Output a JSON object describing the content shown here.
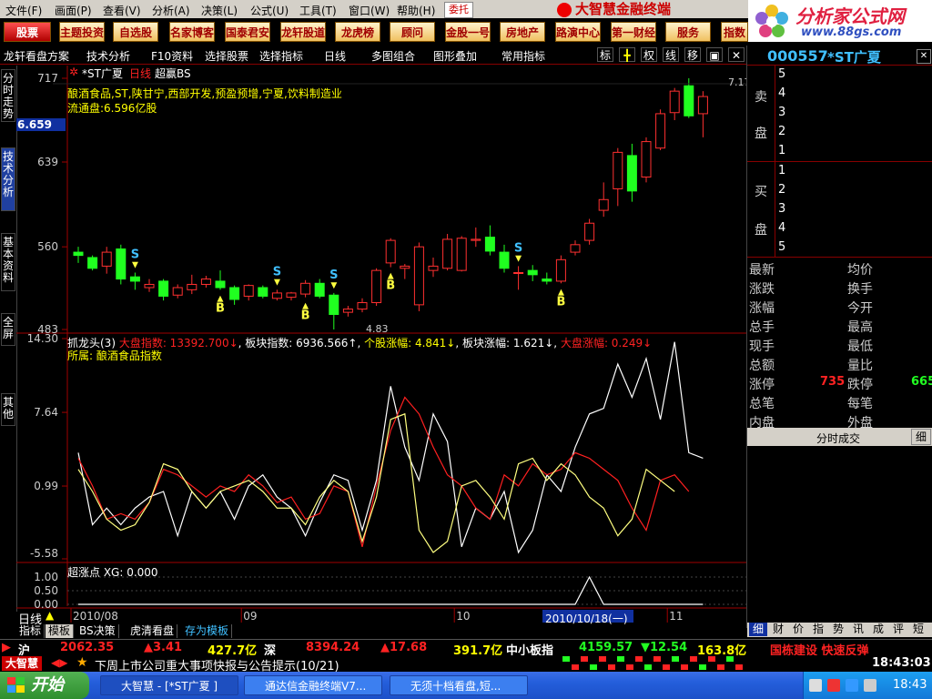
{
  "menu": [
    "文件(F)",
    "画面(P)",
    "查看(V)",
    "分析(A)",
    "决策(L)",
    "公式(U)",
    "工具(T)",
    "窗口(W)",
    "帮助(H)"
  ],
  "weituo": "委托",
  "brand": "大智慧金融终端",
  "site": {
    "name": "分析家公式网",
    "url": "www.88gs.com"
  },
  "toolbar": [
    "股票",
    "主题投资",
    "自选股",
    "名家博客",
    "国泰君安",
    "龙轩股道",
    "龙虎榜",
    "顾问",
    "金股一号",
    "房地产",
    "路演中心",
    "第一财经",
    "服务",
    "指数"
  ],
  "tabrow": [
    "龙轩看盘方案",
    "技术分析",
    "F10资料",
    "选择股票",
    "选择指标",
    "日线",
    "多图组合",
    "图形叠加",
    "常用指标"
  ],
  "tabrow_btns": [
    "标",
    "╋",
    "权",
    "线",
    "移"
  ],
  "left_tabs": [
    "分时走势",
    "技术分析",
    "基本资料",
    "全屏",
    "其他"
  ],
  "chart": {
    "header": "*ST广夏",
    "period": "日线",
    "indicator": "超赢BS",
    "info_line1": "酿酒食品,ST,陕甘宁,西部开发,预盈预增,宁夏,饮料制造业",
    "info_line2": "流通盘:6.596亿股",
    "cur_price": "6.659",
    "low_mark": "4.83",
    "high_mark": "7.17",
    "sub1_name": "抓龙头(3)",
    "sub1_vals": [
      "大盘指数: 13392.700↓",
      "板块指数: 6936.566↑",
      "个股涨幅: 4.841↓",
      "板块涨幅: 1.621↓",
      "大盘涨幅: 0.249↓"
    ],
    "sub1_sector": "所属: 酿酒食品指数",
    "sub2_name": "超涨点 XG: 0.000",
    "date_cursor": "2010/10/18(一)"
  },
  "chart_data": [
    {
      "type": "candlestick",
      "yticks": [
        "717",
        "639",
        "560",
        "483"
      ],
      "ylim": [
        4.83,
        7.17
      ],
      "x_month_labels": [
        "2010/08",
        "09",
        "10",
        "11"
      ],
      "candles": [
        [
          5.55,
          5.52,
          5.6,
          5.45
        ],
        [
          5.5,
          5.4,
          5.52,
          5.38
        ],
        [
          5.42,
          5.55,
          5.6,
          5.35
        ],
        [
          5.58,
          5.3,
          5.62,
          5.25
        ],
        [
          5.32,
          5.28,
          5.36,
          5.2
        ],
        [
          5.22,
          5.25,
          5.3,
          5.18
        ],
        [
          5.28,
          5.14,
          5.3,
          5.1
        ],
        [
          5.15,
          5.22,
          5.25,
          5.12
        ],
        [
          5.2,
          5.25,
          5.34,
          5.16
        ],
        [
          5.25,
          5.3,
          5.33,
          5.22
        ],
        [
          5.28,
          5.22,
          5.38,
          5.2
        ],
        [
          5.22,
          5.11,
          5.24,
          5.06
        ],
        [
          5.14,
          5.24,
          5.25,
          5.1
        ],
        [
          5.22,
          5.14,
          5.24,
          5.12
        ],
        [
          5.12,
          5.17,
          5.2,
          5.1
        ],
        [
          5.13,
          5.17,
          5.18,
          5.1
        ],
        [
          5.16,
          5.26,
          5.29,
          5.13
        ],
        [
          5.26,
          5.14,
          5.3,
          5.12
        ],
        [
          5.15,
          4.97,
          5.17,
          4.83
        ],
        [
          4.99,
          5.02,
          5.05,
          4.95
        ],
        [
          5.02,
          5.08,
          5.12,
          4.99
        ],
        [
          5.08,
          5.38,
          5.4,
          5.05
        ],
        [
          5.45,
          5.66,
          5.68,
          5.41
        ],
        [
          5.4,
          5.42,
          5.44,
          5.3
        ],
        [
          5.06,
          5.6,
          5.64,
          5.0
        ],
        [
          5.38,
          5.42,
          5.5,
          5.32
        ],
        [
          5.4,
          5.67,
          5.72,
          5.38
        ],
        [
          5.38,
          5.68,
          5.7,
          5.37
        ],
        [
          5.66,
          5.67,
          5.78,
          5.6
        ],
        [
          5.69,
          5.56,
          5.8,
          5.52
        ],
        [
          5.55,
          5.4,
          5.62,
          5.36
        ],
        [
          5.36,
          5.36,
          5.42,
          5.2
        ],
        [
          5.38,
          5.34,
          5.43,
          5.28
        ],
        [
          5.3,
          5.28,
          5.36,
          5.25
        ],
        [
          5.28,
          5.48,
          5.52,
          5.26
        ],
        [
          5.55,
          5.62,
          5.66,
          5.52
        ],
        [
          5.66,
          5.82,
          5.86,
          5.62
        ],
        [
          5.94,
          6.04,
          6.2,
          5.88
        ],
        [
          6.14,
          6.48,
          6.52,
          5.98
        ],
        [
          6.45,
          6.12,
          6.56,
          6.02
        ],
        [
          6.25,
          6.58,
          6.62,
          6.2
        ],
        [
          6.52,
          6.84,
          6.88,
          6.5
        ],
        [
          6.85,
          7.05,
          7.08,
          6.78
        ],
        [
          7.1,
          6.82,
          7.17,
          6.8
        ],
        [
          6.84,
          7.0,
          7.05,
          6.62
        ]
      ],
      "signals": [
        {
          "label": "S",
          "i": 4
        },
        {
          "label": "S",
          "i": 14
        },
        {
          "label": "B",
          "i": 10
        },
        {
          "label": "B",
          "i": 16
        },
        {
          "label": "S",
          "i": 18
        },
        {
          "label": "B",
          "i": 22
        },
        {
          "label": "S",
          "i": 31
        },
        {
          "label": "B",
          "i": 34
        }
      ]
    },
    {
      "type": "line",
      "title": "抓龙头(3)",
      "yticks": [
        "14.30",
        "7.64",
        "0.99",
        "-5.58"
      ],
      "ylim": [
        -5.58,
        14.3
      ],
      "series": [
        {
          "color": "#ffffff",
          "values": [
            4.0,
            -2.5,
            -1.0,
            -2.5,
            -1.0,
            0.0,
            0.5,
            -3.5,
            0.5,
            -1.0,
            0.5,
            -2.0,
            1.0,
            2.0,
            0.0,
            -1.0,
            -3.5,
            -0.5,
            2.0,
            1.5,
            -3.0,
            1.5,
            10.0,
            4.5,
            1.5,
            7.5,
            5.0,
            -4.5,
            -1.0,
            -2.0,
            0.5,
            -5.0,
            -3.0,
            2.0,
            0.5,
            4.5,
            7.5,
            8.0,
            12.0,
            9.0,
            12.5,
            7.0,
            14.0,
            4.0,
            3.5
          ]
        },
        {
          "color": "#ff2020",
          "values": [
            3.5,
            1.0,
            -2.0,
            -1.5,
            -2.0,
            -0.5,
            2.5,
            2.0,
            1.0,
            0.0,
            1.0,
            0.5,
            2.0,
            1.0,
            -0.5,
            0.0,
            -2.0,
            -1.5,
            1.0,
            0.5,
            -4.5,
            1.0,
            6.0,
            9.0,
            7.5,
            4.5,
            2.0,
            1.0,
            -1.0,
            -2.0,
            2.0,
            1.0,
            3.0,
            2.0,
            2.5,
            4.0,
            3.5,
            2.5,
            1.5,
            -1.0,
            -3.0,
            1.5,
            2.0,
            0.5
          ]
        },
        {
          "color": "#ffff80",
          "values": [
            2.5,
            0.5,
            -2.0,
            -3.0,
            -2.5,
            -0.5,
            3.0,
            2.5,
            0.5,
            -1.0,
            0.5,
            1.0,
            1.5,
            0.5,
            -1.0,
            -1.0,
            -2.5,
            0.0,
            1.5,
            0.5,
            -4.0,
            0.0,
            7.0,
            7.5,
            -3.0,
            -5.0,
            -4.0,
            1.0,
            1.5,
            0.0,
            -2.0,
            3.0,
            3.5,
            1.5,
            3.0,
            2.0,
            0.0,
            -1.0,
            -3.5,
            -2.0,
            2.5,
            1.5,
            0.5
          ]
        }
      ]
    },
    {
      "type": "line",
      "title": "超涨点",
      "yticks": [
        "1.00",
        "0.50",
        "0.00"
      ],
      "ylim": [
        0,
        1
      ],
      "series": [
        {
          "color": "#ffffff",
          "values": [
            0,
            0,
            0,
            0,
            0,
            0,
            0,
            0,
            0,
            0,
            0,
            0,
            0,
            0,
            0,
            0,
            0,
            0,
            0,
            0,
            0,
            0,
            0,
            0,
            0,
            0,
            0,
            0,
            0,
            0,
            0,
            0,
            0,
            0,
            0,
            0,
            1,
            0,
            0,
            0,
            0,
            0,
            0,
            0,
            0
          ]
        }
      ]
    }
  ],
  "right": {
    "code": "000557",
    "name": "*ST广夏",
    "sell_label_a": "卖",
    "sell_label_b": "盘",
    "buy_label_a": "买",
    "buy_label_b": "盘",
    "sell_levels": [
      "5",
      "4",
      "3",
      "2",
      "1"
    ],
    "buy_levels": [
      "1",
      "2",
      "3",
      "4",
      "5"
    ],
    "stats_left": [
      "最新",
      "涨跌",
      "涨幅",
      "总手",
      "现手",
      "总额",
      "涨停",
      "总笔",
      "内盘"
    ],
    "stats_right": [
      "均价",
      "换手",
      "今开",
      "最高",
      "最低",
      "量比",
      "跌停",
      "每笔",
      "外盘"
    ],
    "zhangting": "735",
    "dieting": "665",
    "fenshi": "分时成交",
    "xi": "细",
    "bottom_tabs": [
      "细",
      "财",
      "价",
      "指",
      "势",
      "讯",
      "成",
      "评",
      "短"
    ]
  },
  "bottom_tabs": [
    "指标",
    "模板",
    "BS决策",
    "虎清看盘",
    "存为模板"
  ],
  "rixian": "日线",
  "index_bar": {
    "sh_label": "沪",
    "sh_val": "2062.35",
    "sh_chg": "▲3.41",
    "sh_amt": "427.7亿",
    "sz_label": "深",
    "sz_val": "8394.24",
    "sz_chg": "▲17.68",
    "sz_amt": "391.7亿",
    "zx_label": "中小板指",
    "zx_val": "4159.57",
    "zx_chg": "▼12.54",
    "zx_amt": "163.8亿",
    "time": "18:43:03"
  },
  "news": {
    "logo": "大智慧",
    "text": "下周上市公司重大事项快报与公告提示(10/21)",
    "ticker": "国栋建设 快速反弹"
  },
  "taskbar": {
    "start": "开始",
    "tasks": [
      "大智慧 - [*ST广夏 ]",
      "通达信金融终端V7...",
      "无须十档看盘,短..."
    ],
    "clock": "18:43"
  }
}
